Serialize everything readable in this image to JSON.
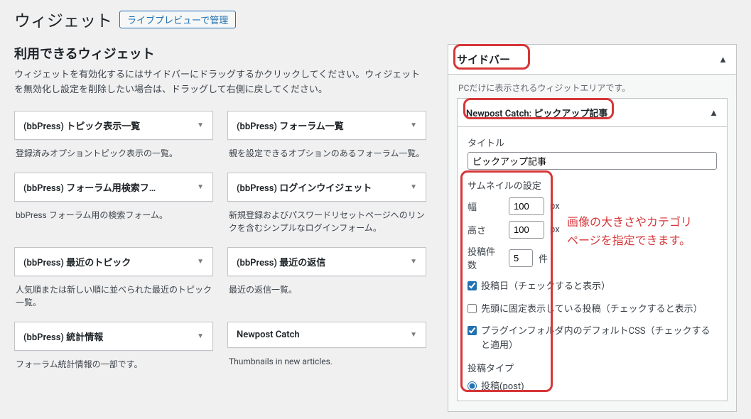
{
  "page": {
    "title": "ウィジェット",
    "preview_button": "ライブプレビューで管理"
  },
  "available": {
    "title": "利用できるウィジェット",
    "desc": "ウィジェットを有効化するにはサイドバーにドラッグするかクリックしてください。ウィジェットを無効化し設定を削除したい場合は、ドラッグして右側に戻してください。",
    "widgets": [
      {
        "title": "(bbPress) トピック表示一覧",
        "desc": "登録済みオプショントピック表示の一覧。"
      },
      {
        "title": "(bbPress) フォーラム一覧",
        "desc": "親を設定できるオプションのあるフォーラム一覧。"
      },
      {
        "title": "(bbPress) フォーラム用検索フ…",
        "desc": "bbPress フォーラム用の検索フォーム。"
      },
      {
        "title": "(bbPress) ログインウイジェット",
        "desc": "新規登録およびパスワードリセットページへのリンクを含むシンプルなログインフォーム。"
      },
      {
        "title": "(bbPress) 最近のトピック",
        "desc": "人気順または新しい順に並べられた最近のトピック一覧。"
      },
      {
        "title": "(bbPress) 最近の返信",
        "desc": "最近の返信一覧。"
      },
      {
        "title": "(bbPress) 統計情報",
        "desc": "フォーラム統計情報の一部です。"
      },
      {
        "title": "Newpost Catch",
        "desc": "Thumbnails in new articles."
      }
    ]
  },
  "sidebar": {
    "name": "サイドバー",
    "desc": "PCだけに表示されるウィジットエリアです。",
    "widget": {
      "header": "Newpost Catch: ピックアップ記事",
      "title_label": "タイトル",
      "title_value": "ピックアップ記事",
      "thumb_heading": "サムネイルの設定",
      "width_label": "幅",
      "width_value": "100",
      "height_label": "高さ",
      "height_value": "100",
      "px": "px",
      "count_label": "投稿件数",
      "count_value": "5",
      "count_unit": "件",
      "check_date": "投稿日（チェックすると表示）",
      "check_sticky": "先頭に固定表示している投稿（チェックすると表示）",
      "check_css": "プラグインフォルダ内のデフォルトCSS（チェックすると適用）",
      "post_type_label": "投稿タイプ",
      "post_type_option": "投稿(post)"
    }
  },
  "annotation": {
    "line1": "画像の大きさやカテゴリ",
    "line2": "ページを指定できます。"
  }
}
